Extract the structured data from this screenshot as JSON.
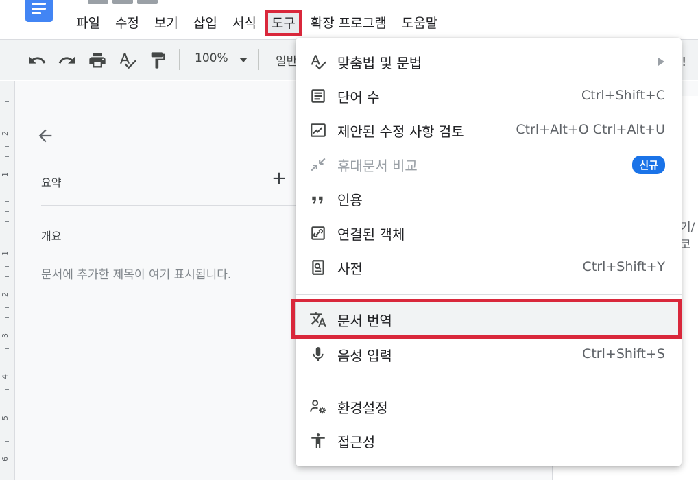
{
  "menubar": {
    "items": [
      "파일",
      "수정",
      "보기",
      "삽입",
      "서식",
      "도구",
      "확장 프로그램",
      "도움말"
    ],
    "active_index": 5
  },
  "toolbar": {
    "zoom": "100%",
    "style_partial": "일반"
  },
  "outline": {
    "summary_label": "요약",
    "add_symbol": "+",
    "outline_label": "개요",
    "empty_hint": "문서에 추가한 제목이 여기 표시됩니다."
  },
  "page": {
    "partial_text": "기/코",
    "right_stub": "!"
  },
  "ruler": {
    "numbers": [
      "2",
      "1",
      "1",
      "2",
      "3",
      "4",
      "5",
      "6"
    ]
  },
  "tools_menu": {
    "items": [
      {
        "label": "맞춤법 및 문법",
        "shortcut": "",
        "icon": "spellcheck-icon",
        "submenu": true
      },
      {
        "label": "단어 수",
        "shortcut": "Ctrl+Shift+C",
        "icon": "word-count-icon"
      },
      {
        "label": "제안된 수정 사항 검토",
        "shortcut": "Ctrl+Alt+O Ctrl+Alt+U",
        "icon": "review-edits-icon"
      },
      {
        "label": "휴대문서 비교",
        "shortcut": "",
        "icon": "compare-icon",
        "badge": "신규",
        "disabled": true
      },
      {
        "label": "인용",
        "shortcut": "",
        "icon": "quote-icon"
      },
      {
        "label": "연결된 객체",
        "shortcut": "",
        "icon": "linked-objects-icon"
      },
      {
        "label": "사전",
        "shortcut": "Ctrl+Shift+Y",
        "icon": "dictionary-icon"
      },
      {
        "label": "문서 번역",
        "shortcut": "",
        "icon": "translate-icon",
        "highlighted": true
      },
      {
        "label": "음성 입력",
        "shortcut": "Ctrl+Shift+S",
        "icon": "microphone-icon"
      },
      {
        "label": "환경설정",
        "shortcut": "",
        "icon": "preferences-icon"
      },
      {
        "label": "접근성",
        "shortcut": "",
        "icon": "accessibility-icon"
      }
    ]
  },
  "colors": {
    "highlight_border": "#d9273b",
    "badge": "#1a73e8",
    "docs_blue": "#4285f4"
  }
}
